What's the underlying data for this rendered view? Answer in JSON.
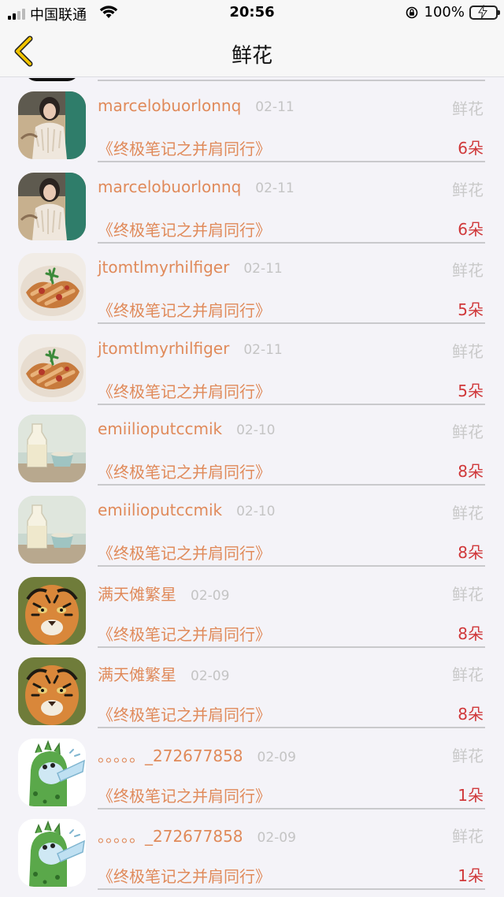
{
  "status_bar": {
    "carrier": "中国联通",
    "time": "20:56",
    "battery": "100%",
    "battery_level": 1.0
  },
  "nav": {
    "title": "鲜花"
  },
  "rows": [
    {
      "name": "marcelobuorlonnq",
      "date": "02-11",
      "gift": "鲜花",
      "book": "《终极笔记之并肩同行》",
      "count": "6朵",
      "avatar": "woman-photo"
    },
    {
      "name": "marcelobuorlonnq",
      "date": "02-11",
      "gift": "鲜花",
      "book": "《终极笔记之并肩同行》",
      "count": "6朵",
      "avatar": "woman-photo"
    },
    {
      "name": "jtomtlmyrhilfiger",
      "date": "02-11",
      "gift": "鲜花",
      "book": "《终极笔记之并肩同行》",
      "count": "5朵",
      "avatar": "food-photo"
    },
    {
      "name": "jtomtlmyrhilfiger",
      "date": "02-11",
      "gift": "鲜花",
      "book": "《终极笔记之并肩同行》",
      "count": "5朵",
      "avatar": "food-photo"
    },
    {
      "name": "emiilioputccmik",
      "date": "02-10",
      "gift": "鲜花",
      "book": "《终极笔记之并肩同行》",
      "count": "8朵",
      "avatar": "milk-photo"
    },
    {
      "name": "emiilioputccmik",
      "date": "02-10",
      "gift": "鲜花",
      "book": "《终极笔记之并肩同行》",
      "count": "8朵",
      "avatar": "milk-photo"
    },
    {
      "name": "满天傩繁星",
      "date": "02-09",
      "gift": "鲜花",
      "book": "《终极笔记之并肩同行》",
      "count": "8朵",
      "avatar": "tiger-photo"
    },
    {
      "name": "满天傩繁星",
      "date": "02-09",
      "gift": "鲜花",
      "book": "《终极笔记之并肩同行》",
      "count": "8朵",
      "avatar": "tiger-photo"
    },
    {
      "name": "。。。。。_272677858",
      "date": "02-09",
      "gift": "鲜花",
      "book": "《终极笔记之并肩同行》",
      "count": "1朵",
      "avatar": "dinosaur-cartoon"
    },
    {
      "name": "。。。。。_272677858",
      "date": "02-09",
      "gift": "鲜花",
      "book": "《终极笔记之并肩同行》",
      "count": "1朵",
      "avatar": "dinosaur-cartoon"
    }
  ]
}
